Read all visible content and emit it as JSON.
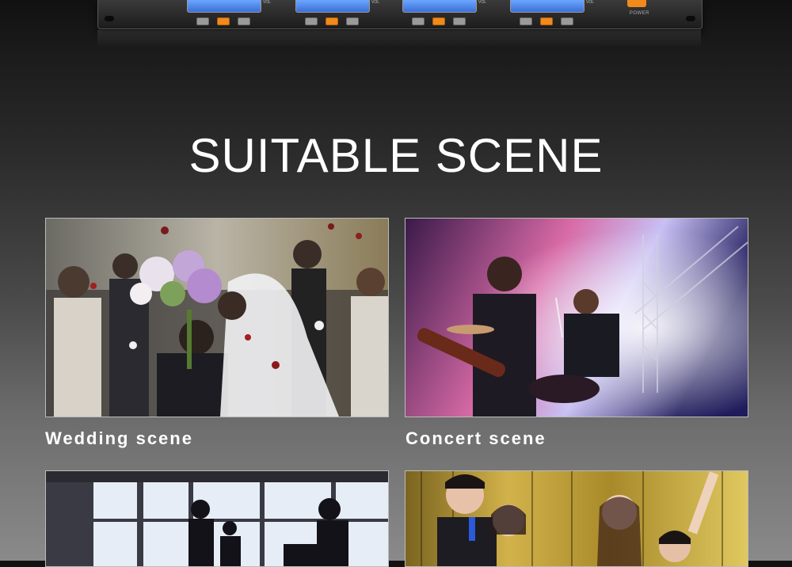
{
  "device": {
    "vol_label": "VOL",
    "power_label": "POWER"
  },
  "heading": {
    "title": "SUITABLE SCENE"
  },
  "scenes": [
    {
      "label": "Wedding scene",
      "image": "wedding-photo"
    },
    {
      "label": "Concert scene",
      "image": "concert-photo"
    },
    {
      "label": "",
      "image": "conference-photo"
    },
    {
      "label": "",
      "image": "karaoke-party-photo"
    }
  ],
  "colors": {
    "accent_orange": "#f08a1c",
    "lcd_blue": "#4a86ee",
    "title_text": "#ffffff"
  }
}
